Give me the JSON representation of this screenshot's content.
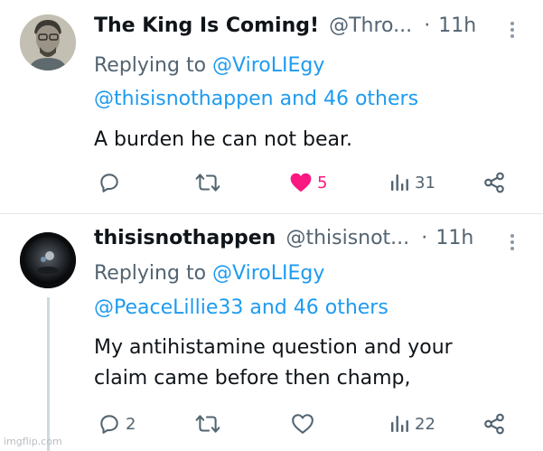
{
  "tweets": [
    {
      "name": "The King Is Coming!",
      "handle": "@Thro...",
      "separator": "·",
      "time": "11h",
      "replying_prefix": "Replying to",
      "replying_user": "@ViroLIEgy",
      "replying_others_user": "@thisisnothappen",
      "replying_others_suffix": "and 46 others",
      "text_lines": [
        "A burden he can not bear."
      ],
      "actions": {
        "reply_count": "",
        "retweet_count": "",
        "like_count": "5",
        "liked": true,
        "views_count": "31"
      }
    },
    {
      "name": "thisisnothappen",
      "handle": "@thisisnot...",
      "separator": "·",
      "time": "11h",
      "replying_prefix": "Replying to",
      "replying_user": "@ViroLIEgy",
      "replying_others_user": "@PeaceLillie33",
      "replying_others_suffix": "and 46 others",
      "text_lines": [
        "My antihistamine question and your",
        "claim came before then champ,"
      ],
      "actions": {
        "reply_count": "2",
        "retweet_count": "",
        "like_count": "",
        "liked": false,
        "views_count": "22"
      }
    }
  ],
  "icons": {
    "reply": "reply-icon",
    "retweet": "retweet-icon",
    "like": "heart-icon",
    "views": "views-icon",
    "share": "share-icon",
    "more": "more-icon"
  },
  "colors": {
    "link": "#1d9bf0",
    "secondary": "#536471",
    "like": "#f91880",
    "divider": "#e4e8eb"
  },
  "watermark": "imgflip.com"
}
